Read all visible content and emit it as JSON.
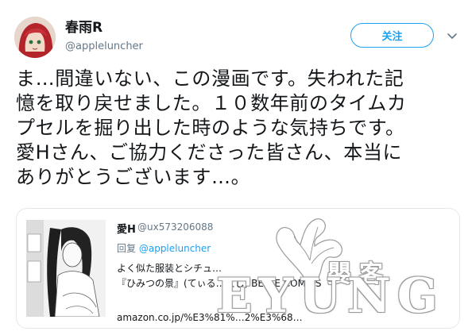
{
  "user": {
    "display_name": "春雨R",
    "handle": "@appleluncher"
  },
  "header": {
    "follow_label": "关注"
  },
  "tweet": {
    "lines": [
      "ま…間違いない、この漫画です。失われた記",
      "憶を取り戻せました。１０数年前のタイムカ",
      "プセルを掘り出した時のような気持ちです。",
      "愛Hさん、ご協力くださった皆さん、本当に",
      "ありがとうございます…。"
    ]
  },
  "quote": {
    "name": "愛H",
    "handle": "@ux573206088",
    "reply_prefix": "回复",
    "reply_to": "@appleluncher",
    "body_lines": [
      "よく似た服装とシチュ…",
      "『ひみつの景』(てぃる…えし) BELLE COMICS"
    ],
    "link": "amazon.co.jp/%E3%81%…2%E3%68…"
  },
  "watermark": {
    "latin": "EYUNG",
    "cjk": "嬰客"
  },
  "icons": {
    "more": "chevron-down-icon",
    "avatar": "anime-avatar",
    "thumb": "manga-cover-image"
  },
  "colors": {
    "accent": "#1da1f2",
    "text": "#14171a",
    "muted": "#657786",
    "border": "#e1e8ed"
  }
}
